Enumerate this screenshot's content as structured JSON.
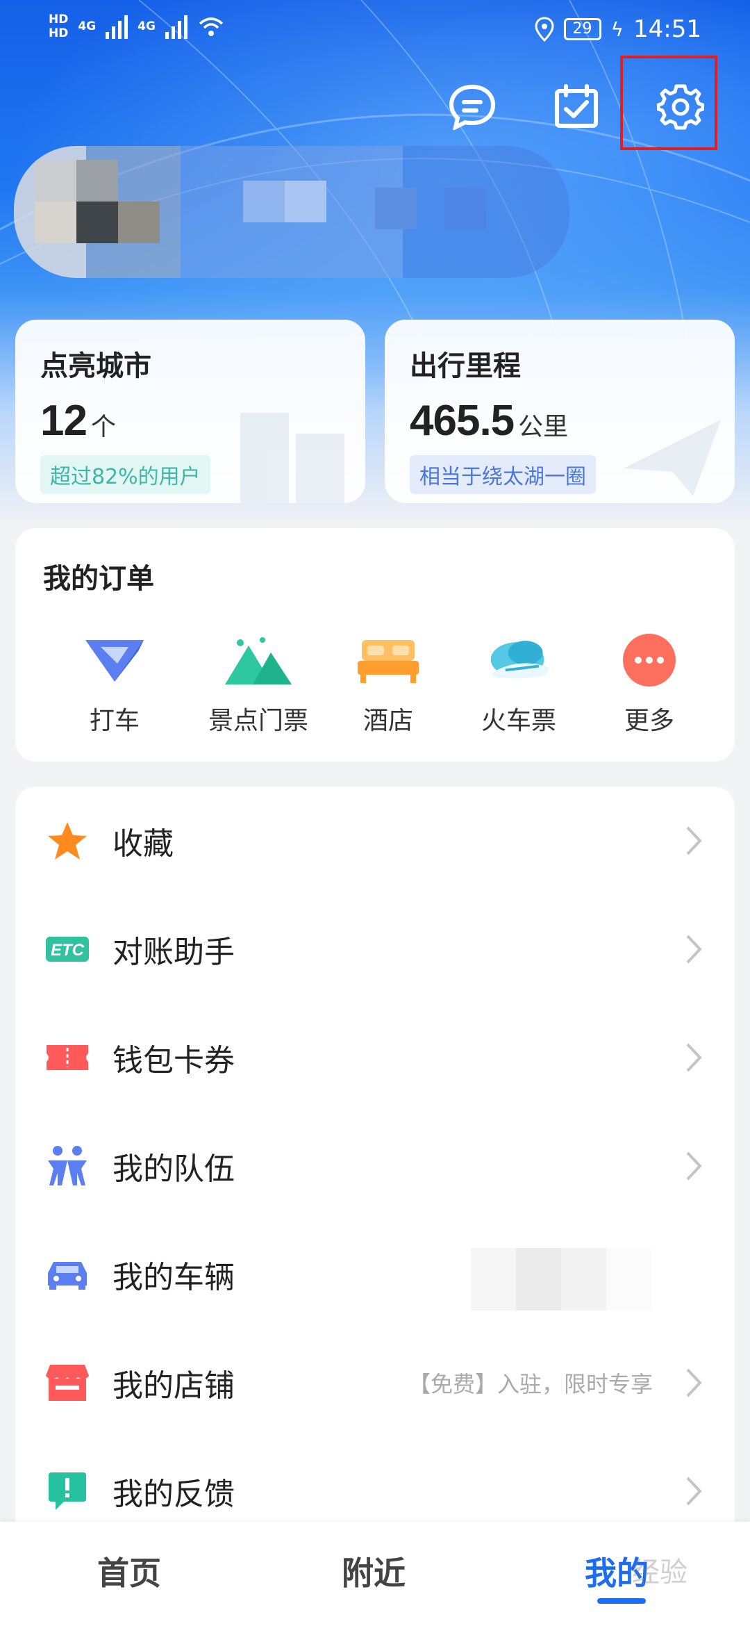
{
  "status_bar": {
    "time": "14:51",
    "battery": "29",
    "network_1": "4G",
    "network_2": "4G",
    "hd_1": "HD",
    "hd_2": "HD"
  },
  "header_icons": {
    "message": "message-icon",
    "checkin": "calendar-check-icon",
    "settings": "gear-icon"
  },
  "stats": {
    "city": {
      "title": "点亮城市",
      "value": "12",
      "unit": "个",
      "badge": "超过82%的用户"
    },
    "mileage": {
      "title": "出行里程",
      "value": "465.5",
      "unit": "公里",
      "badge": "相当于绕太湖一圈"
    }
  },
  "orders": {
    "title": "我的订单",
    "items": [
      {
        "label": "打车",
        "icon": "taxi-icon"
      },
      {
        "label": "景点门票",
        "icon": "mountain-icon"
      },
      {
        "label": "酒店",
        "icon": "bed-icon"
      },
      {
        "label": "火车票",
        "icon": "train-icon"
      },
      {
        "label": "更多",
        "icon": "more-icon"
      }
    ]
  },
  "menu": [
    {
      "label": "收藏",
      "icon": "star-icon",
      "hint": ""
    },
    {
      "label": "对账助手",
      "icon": "etc-icon",
      "hint": ""
    },
    {
      "label": "钱包卡券",
      "icon": "ticket-icon",
      "hint": ""
    },
    {
      "label": "我的队伍",
      "icon": "team-icon",
      "hint": ""
    },
    {
      "label": "我的车辆",
      "icon": "car-icon",
      "hint": ""
    },
    {
      "label": "我的店铺",
      "icon": "shop-icon",
      "hint": "【免费】入驻，限时专享"
    },
    {
      "label": "我的反馈",
      "icon": "feedback-icon",
      "hint": ""
    }
  ],
  "bottom_nav": {
    "home": "首页",
    "nearby": "附近",
    "mine": "我的",
    "watermark": "经验"
  },
  "colors": {
    "accent": "#1d6cf2",
    "highlight": "#e02020"
  }
}
